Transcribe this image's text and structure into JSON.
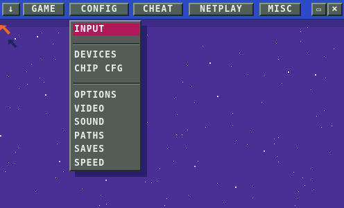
{
  "menubar": {
    "dropdown_arrow_glyph": "↓",
    "items": [
      {
        "label": "GAME"
      },
      {
        "label": "CONFIG"
      },
      {
        "label": "CHEAT"
      },
      {
        "label": "NETPLAY"
      },
      {
        "label": "MISC"
      }
    ],
    "active_item": "CONFIG",
    "window_buttons": {
      "restore_glyph": "▭",
      "close_glyph": "×"
    }
  },
  "config_menu": {
    "groups": [
      [
        {
          "label": "INPUT",
          "selected": true
        }
      ],
      [
        {
          "label": "DEVICES"
        },
        {
          "label": "CHIP CFG"
        }
      ],
      [
        {
          "label": "OPTIONS"
        },
        {
          "label": "VIDEO"
        },
        {
          "label": "SOUND"
        },
        {
          "label": "PATHS"
        },
        {
          "label": "SAVES"
        },
        {
          "label": "SPEED"
        }
      ]
    ]
  },
  "colors": {
    "background": "#4a2f94",
    "menubar": "#2d4bc6",
    "button_face": "#4f5f56",
    "selection": "#b01858",
    "cursor_orange": "#f06a1a"
  }
}
